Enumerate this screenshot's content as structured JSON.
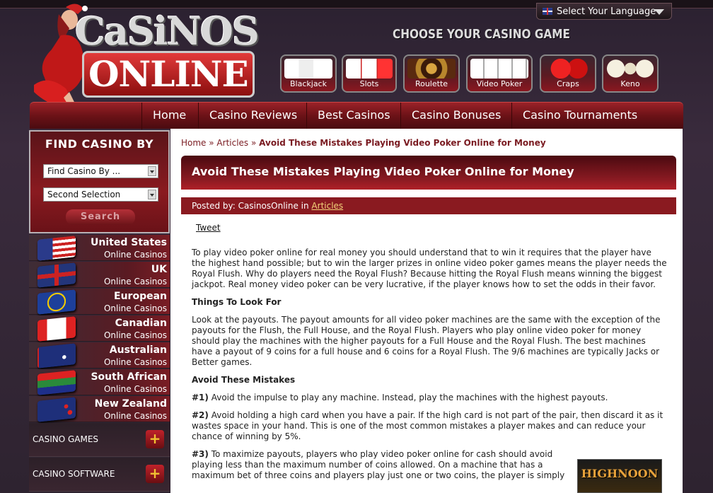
{
  "language": {
    "label": "Select Your Language"
  },
  "logo": {
    "line1": "CaSiNOS",
    "line2": "ONLINE"
  },
  "choose_heading": "CHOOSE YOUR CASINO GAME",
  "games": [
    {
      "label": "Blackjack",
      "icon": "cards-icon"
    },
    {
      "label": "Slots",
      "icon": "slot-icon"
    },
    {
      "label": "Roulette",
      "icon": "roulette-icon"
    },
    {
      "label": "Video Poker",
      "icon": "poker-cards-icon"
    },
    {
      "label": "Craps",
      "icon": "dice-icon"
    },
    {
      "label": "Keno",
      "icon": "keno-balls-icon"
    }
  ],
  "nav": [
    "Home",
    "Casino Reviews",
    "Best Casinos",
    "Casino Bonuses",
    "Casino Tournaments"
  ],
  "find": {
    "title": "FIND CASINO BY",
    "select1": "Find Casino By ...",
    "select2": "Second Selection",
    "search": "Search"
  },
  "countries": [
    {
      "name": "United States",
      "sub": "Online Casinos"
    },
    {
      "name": "UK",
      "sub": "Online Casinos"
    },
    {
      "name": "European",
      "sub": "Online Casinos"
    },
    {
      "name": "Canadian",
      "sub": "Online Casinos"
    },
    {
      "name": "Australian",
      "sub": "Online Casinos"
    },
    {
      "name": "South African",
      "sub": "Online Casinos"
    },
    {
      "name": "New Zealand",
      "sub": "Online Casinos"
    }
  ],
  "categories": [
    {
      "label": "CASINO GAMES",
      "toggle": "+"
    },
    {
      "label": "CASINO SOFTWARE",
      "toggle": "+"
    }
  ],
  "breadcrumb": {
    "home": "Home",
    "sep": " » ",
    "articles": "Articles",
    "current": "Avoid These Mistakes Playing Video Poker Online for Money"
  },
  "article": {
    "title": "Avoid These Mistakes Playing Video Poker Online for Money",
    "posted_by": "Posted by: CasinosOnline in ",
    "category": "Articles",
    "tweet": "Tweet",
    "p1": "To play video poker online for real money you should understand that to win it requires that the player have the highest hand possible; but to win the larger prizes in online video poker games means the player needs the Royal Flush. Why do players need the Royal Flush? Because hitting the Royal Flush means winning the biggest jackpot. Real money video poker can be very lucrative, if the player knows how to set the odds in their favor.",
    "h1": "Things To Look For",
    "p2": "Look at the payouts. The payout amounts for all video poker machines are the same with the exception of the payouts for the Flush, the Full House, and the Royal Flush. Players who play online video poker for money should play the machines with the higher payouts for a Full House and the Royal Flush. The best machines have a payout of 9 coins for a full house and 6 coins for a Royal Flush. The 9/6 machines are typically Jacks or Better games.",
    "h2": "Avoid These Mistakes",
    "m1_num": "#1)",
    "m1": " Avoid the impulse to play any machine. Instead, play the machines with the highest payouts.",
    "m2_num": "#2)",
    "m2": " Avoid holding a high card when you have a pair. If the high card is not part of the pair, then discard it as it wastes space in your hand. This is one of the most common mistakes a player makes and can reduce your chance of winning by 5%.",
    "m3_num": "#3)",
    "m3": " To maximize payouts, players who play video poker online for cash should avoid playing less than the maximum number of coins allowed. On a machine that has a maximum bet of three coins and players play just one or two coins, the player is simply"
  },
  "ad": {
    "text": "HIGHNOON"
  }
}
